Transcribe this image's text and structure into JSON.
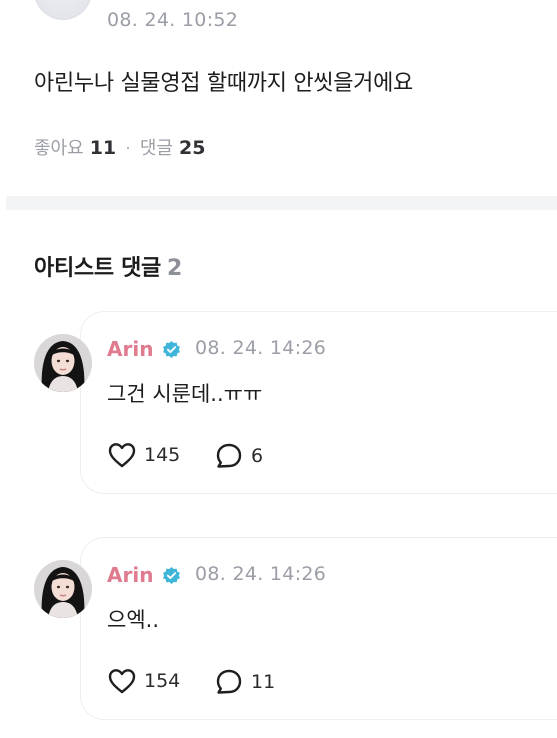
{
  "post": {
    "time": "08. 24. 10:52",
    "body": "아린누나 실물영접 할때까지 안씻을거에요",
    "likes_label": "좋아요",
    "likes_count": "11",
    "separator": "·",
    "comments_label": "댓글",
    "comments_count": "25"
  },
  "artist_comments": {
    "title": "아티스트 댓글",
    "count": "2",
    "items": [
      {
        "author": "Arin",
        "time": "08. 24. 14:26",
        "text": "그건 시룬데..ㅠㅠ",
        "likes": "145",
        "replies": "6"
      },
      {
        "author": "Arin",
        "time": "08. 24. 14:26",
        "text": "으엑..",
        "likes": "154",
        "replies": "11"
      }
    ]
  },
  "colors": {
    "author_name": "#e07a8e",
    "verified_badge": "#3fb6d9",
    "muted_text": "#9b9ea6",
    "divider": "#f3f4f6"
  },
  "icons": {
    "verified": "verified-badge-icon",
    "like": "heart-icon",
    "reply": "speech-bubble-icon"
  }
}
